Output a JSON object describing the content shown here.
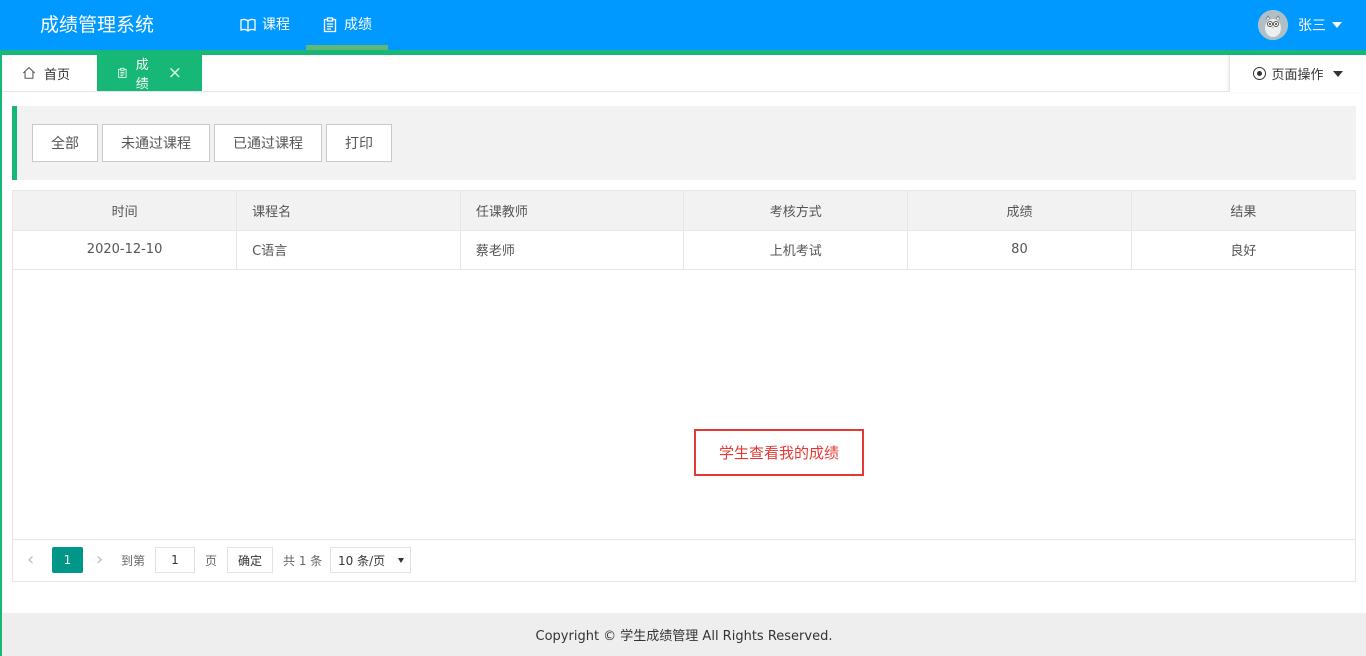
{
  "app": {
    "title": "成绩管理系统",
    "colors": {
      "header": "#0099ff",
      "accent": "#16b777",
      "pager": "#009688",
      "annotation": "#e53935"
    }
  },
  "nav": [
    {
      "label": "课程",
      "icon": "book-icon"
    },
    {
      "label": "成绩",
      "icon": "clipboard-icon",
      "active": true
    }
  ],
  "user": {
    "name": "张三",
    "avatar": "owl-avatar"
  },
  "tabs": {
    "home": {
      "label": "首页",
      "icon": "home-icon"
    },
    "active": {
      "label": "成绩",
      "icon": "clipboard-icon",
      "close": "×"
    },
    "page_ops": "页面操作"
  },
  "toolbar": {
    "buttons": [
      "全部",
      "未通过课程",
      "已通过课程",
      "打印"
    ]
  },
  "table": {
    "headers": [
      "时间",
      "课程名",
      "任课教师",
      "考核方式",
      "成绩",
      "结果"
    ],
    "rows": [
      [
        "2020-12-10",
        "C语言",
        "蔡老师",
        "上机考试",
        "80",
        "良好"
      ]
    ]
  },
  "pager": {
    "current": "1",
    "goto_label": "到第",
    "page_label": "页",
    "confirm": "确定",
    "total": "共 1 条",
    "page_size": "10 条/页",
    "input_value": "1"
  },
  "annotation": "学生查看我的成绩",
  "footer": "Copyright © 学生成绩管理 All Rights Reserved."
}
